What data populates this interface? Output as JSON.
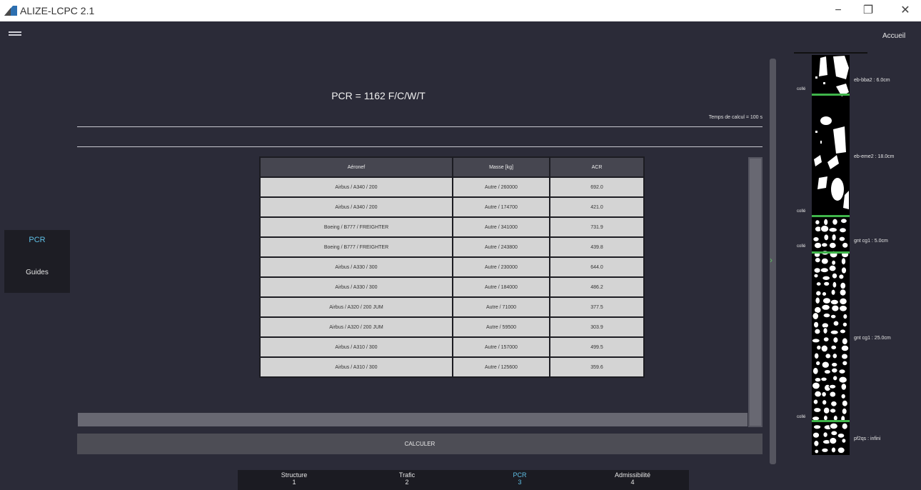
{
  "window": {
    "title": "ALIZE-LCPC 2.1",
    "minimize_glyph": "−",
    "maximize_glyph": "❐",
    "close_glyph": "✕"
  },
  "header": {
    "menu_icon": "hamburger-menu-icon",
    "home_label": "Accueil"
  },
  "left_nav": {
    "items": [
      {
        "label": "PCR",
        "active": true
      },
      {
        "label": "Guides",
        "active": false
      }
    ]
  },
  "main": {
    "pcr_result": "PCR = 1162 F/C/W/T",
    "calc_time": "Temps de calcul = 100 s",
    "table": {
      "headers": [
        "Aéronef",
        "Masse [kg]",
        "ACR"
      ],
      "rows": [
        [
          "Airbus / A340 / 200",
          "Autre / 260000",
          "692.0"
        ],
        [
          "Airbus / A340 / 200",
          "Autre / 174700",
          "421.0"
        ],
        [
          "Boeing / B777 / FREIGHTER",
          "Autre / 341000",
          "731.9"
        ],
        [
          "Boeing / B777 / FREIGHTER",
          "Autre / 243800",
          "439.8"
        ],
        [
          "Airbus / A330 / 300",
          "Autre / 230000",
          "644.0"
        ],
        [
          "Airbus / A330 / 300",
          "Autre / 184000",
          "486.2"
        ],
        [
          "Airbus / A320 / 200 JUM",
          "Autre / 71000",
          "377.5"
        ],
        [
          "Airbus / A320 / 200 JUM",
          "Autre / 59500",
          "303.9"
        ],
        [
          "Airbus / A310 / 300",
          "Autre / 157000",
          "499.5"
        ],
        [
          "Airbus / A310 / 300",
          "Autre / 125600",
          "359.6"
        ]
      ]
    },
    "calculate_label": "CALCULER"
  },
  "bottom_tabs": [
    {
      "label": "Structure",
      "num": "1",
      "active": false
    },
    {
      "label": "Trafic",
      "num": "2",
      "active": false
    },
    {
      "label": "PCR",
      "num": "3",
      "active": true
    },
    {
      "label": "Admissibilité",
      "num": "4",
      "active": false
    }
  ],
  "structure": {
    "layers": [
      {
        "label": "eb-bba2 : 6.0cm"
      },
      {
        "label": "eb-eme2 : 18.0cm"
      },
      {
        "label": "gnt cg1 : 5.0cm"
      },
      {
        "label": "gnt cg1 : 25.0cm"
      },
      {
        "label": "pf2qs : infini"
      }
    ],
    "interfaces": [
      "collé",
      "collé",
      "collé",
      "collé"
    ],
    "interface_color": "#3fb54a",
    "accent_color": "#5fc0e6"
  }
}
